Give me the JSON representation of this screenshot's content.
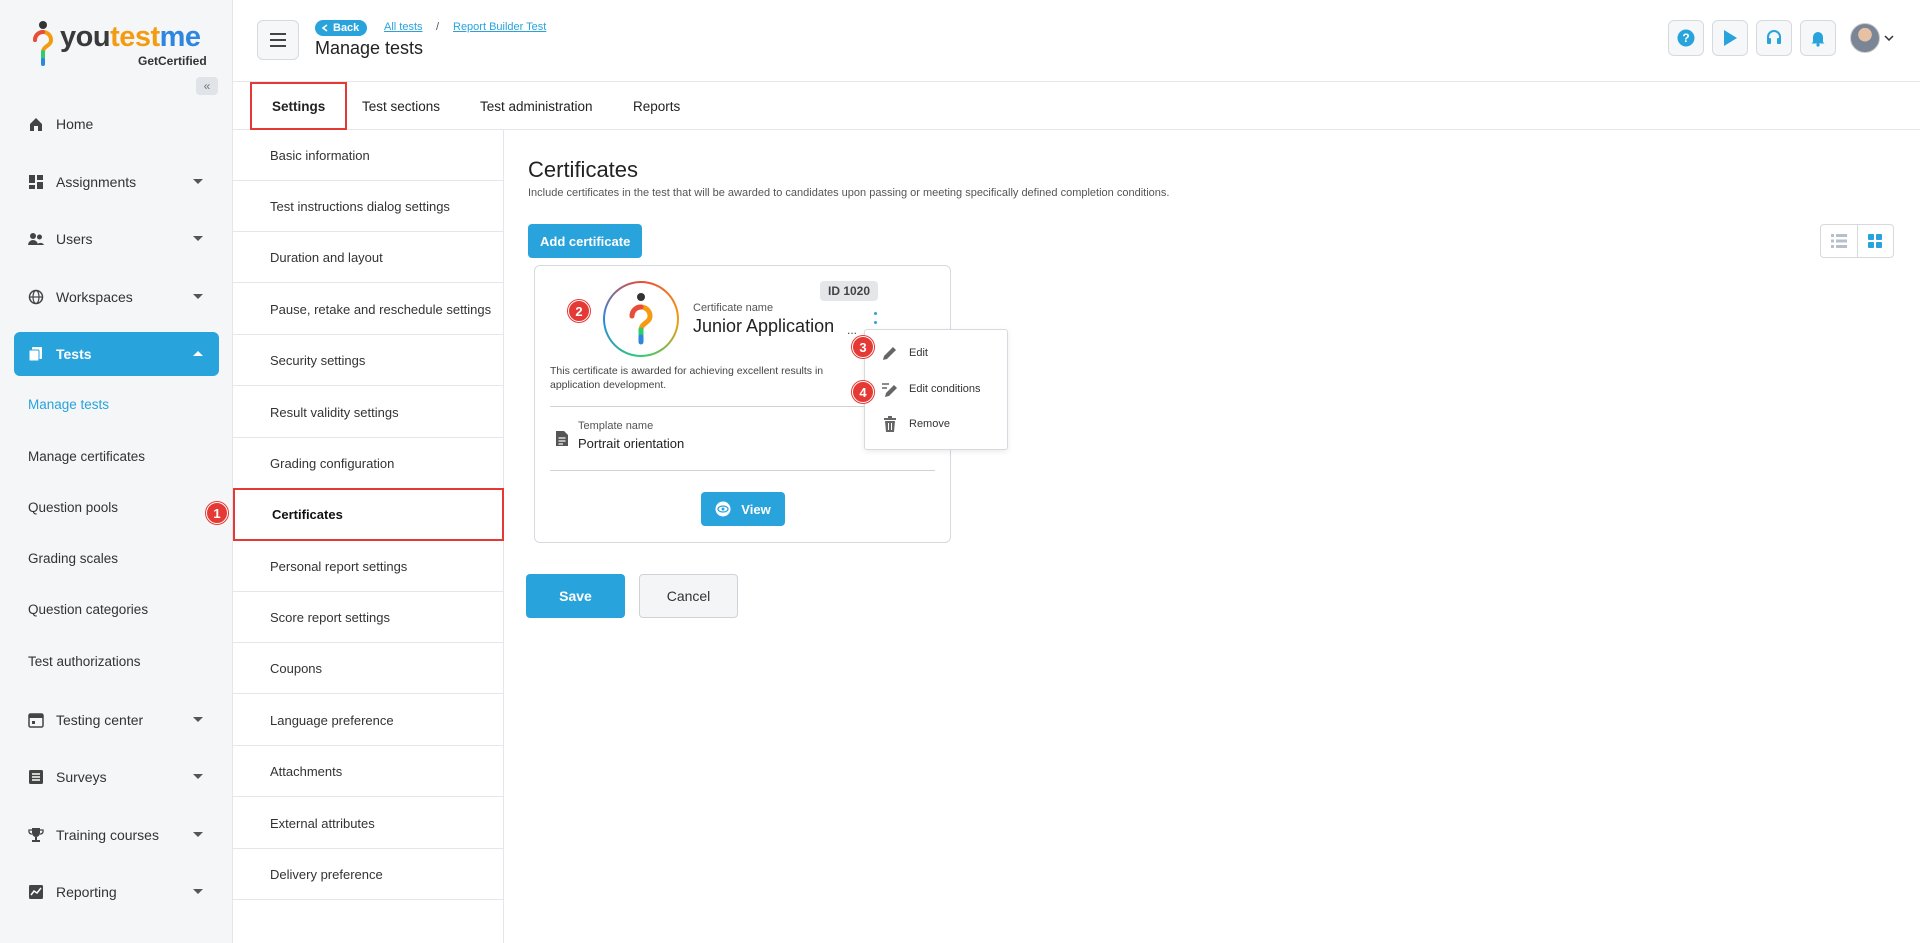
{
  "brand": {
    "you": "you",
    "test": "test",
    "me": "me",
    "sub": "GetCertified"
  },
  "sidebar": {
    "collapse_icon": "«",
    "items": [
      {
        "label": "Home",
        "icon": "home-icon"
      },
      {
        "label": "Assignments",
        "icon": "dashboard-icon"
      },
      {
        "label": "Users",
        "icon": "users-icon"
      },
      {
        "label": "Workspaces",
        "icon": "globe-icon"
      },
      {
        "label": "Tests",
        "icon": "files-icon"
      },
      {
        "label": "Testing center",
        "icon": "calendar-icon"
      },
      {
        "label": "Surveys",
        "icon": "list-icon"
      },
      {
        "label": "Training courses",
        "icon": "trophy-icon"
      },
      {
        "label": "Reporting",
        "icon": "chart-icon"
      }
    ],
    "tests_subitems": [
      "Manage tests",
      "Manage certificates",
      "Question pools",
      "Grading scales",
      "Question categories",
      "Test authorizations"
    ]
  },
  "header": {
    "back": "Back",
    "crumbs": [
      "All tests",
      "Report Builder Test"
    ],
    "separator": "/",
    "title": "Manage tests"
  },
  "tabs": [
    "Settings",
    "Test sections",
    "Test administration",
    "Reports"
  ],
  "settings_menu": [
    "Basic information",
    "Test instructions dialog settings",
    "Duration and layout",
    "Pause, retake and reschedule settings",
    "Security settings",
    "Result validity settings",
    "Grading configuration",
    "Certificates",
    "Personal report settings",
    "Score report settings",
    "Coupons",
    "Language preference",
    "Attachments",
    "External attributes",
    "Delivery preference"
  ],
  "main": {
    "title": "Certificates",
    "subtitle": "Include certificates in the test that will be awarded to candidates upon passing or meeting specifically defined completion conditions.",
    "add_button": "Add certificate"
  },
  "certificate": {
    "id": "ID 1020",
    "name_label": "Certificate name",
    "name": "Junior Application",
    "ellipsis": "...",
    "description": "This certificate is awarded for achieving excellent results in application development.",
    "template_label": "Template name",
    "template_value": "Portrait orientation",
    "view_button": "View"
  },
  "dropdown": [
    "Edit",
    "Edit conditions",
    "Remove"
  ],
  "steps": [
    "1",
    "2",
    "3",
    "4"
  ],
  "actions": {
    "save": "Save",
    "cancel": "Cancel"
  },
  "colors": {
    "accent": "#29a3dc",
    "highlight": "#e53935"
  }
}
